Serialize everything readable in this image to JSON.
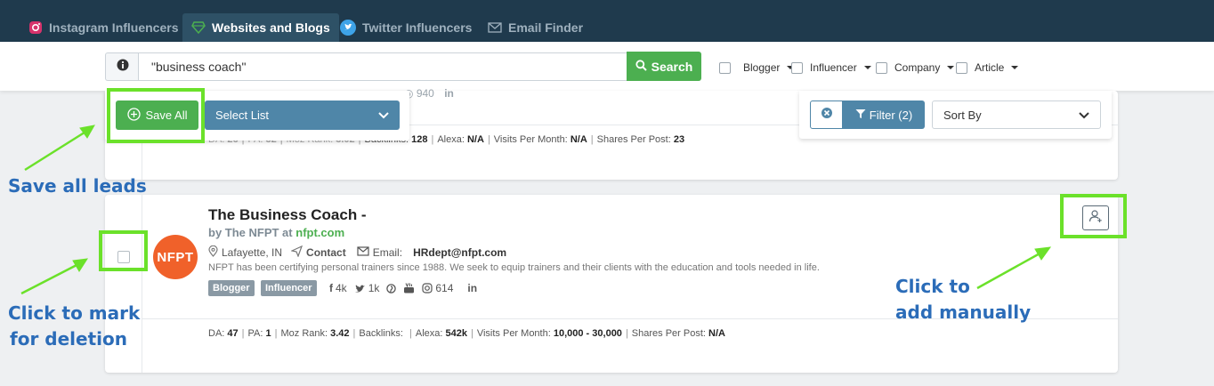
{
  "tabs": [
    {
      "label": "Instagram Influencers",
      "icon": "instagram-icon"
    },
    {
      "label": "Websites and Blogs",
      "icon": "diamond-icon",
      "active": true
    },
    {
      "label": "Twitter Influencers",
      "icon": "twitter-icon"
    },
    {
      "label": "Email Finder",
      "icon": "envelope-icon"
    }
  ],
  "search": {
    "value": "\"business coach\"",
    "button_label": "Search"
  },
  "facets": [
    {
      "label": "Blogger"
    },
    {
      "label": "Influencer"
    },
    {
      "label": "Company"
    },
    {
      "label": "Article"
    }
  ],
  "bulk": {
    "save_all_label": "Save All",
    "select_list_label": "Select List"
  },
  "filters": {
    "filter_label": "Filter (2)",
    "sort_label": "Sort By"
  },
  "card1": {
    "faint_count": "940",
    "metrics": {
      "da_label": "DA:",
      "da": "26",
      "pa_label": "PA:",
      "pa": "32",
      "moz_label": "Moz Rank:",
      "moz": "3.02",
      "backlinks_label": "Backlinks:",
      "backlinks": "128",
      "alexa_label": "Alexa:",
      "alexa": "N/A",
      "visits_label": "Visits Per Month:",
      "visits": "N/A",
      "shares_label": "Shares Per Post:",
      "shares": "23"
    }
  },
  "card2": {
    "logo_text": "NFPT",
    "title": "The Business Coach -",
    "by_prefix": "by The NFPT at",
    "site": "nfpt.com",
    "location": "Lafayette, IN",
    "contact_label": "Contact",
    "email_label": "Email:",
    "email": "HRdept@nfpt.com",
    "description": "NFPT has been certifying personal trainers since 1988. We seek to equip trainers and their clients with the education and tools needed in life.",
    "tags": [
      "Blogger",
      "Influencer"
    ],
    "socials": {
      "facebook": "4k",
      "twitter": "1k",
      "instagram": "614"
    },
    "metrics": {
      "da_label": "DA:",
      "da": "47",
      "pa_label": "PA:",
      "pa": "1",
      "moz_label": "Moz Rank:",
      "moz": "3.42",
      "backlinks_label": "Backlinks:",
      "backlinks": "",
      "alexa_label": "Alexa:",
      "alexa": "542k",
      "visits_label": "Visits Per Month:",
      "visits": "10,000 - 30,000",
      "shares_label": "Shares Per Post:",
      "shares": "N/A"
    }
  },
  "annotations": {
    "save_all": "Save all leads",
    "mark_line1": "Click to mark",
    "mark_line2": "for deletion",
    "add_line1": "Click to",
    "add_line2": "add manually"
  },
  "colors": {
    "nav_bg": "#1f3a4d",
    "green": "#4caf50",
    "blue": "#4f86a8",
    "highlight": "#6be12a",
    "annotation": "#2b6cb8"
  }
}
